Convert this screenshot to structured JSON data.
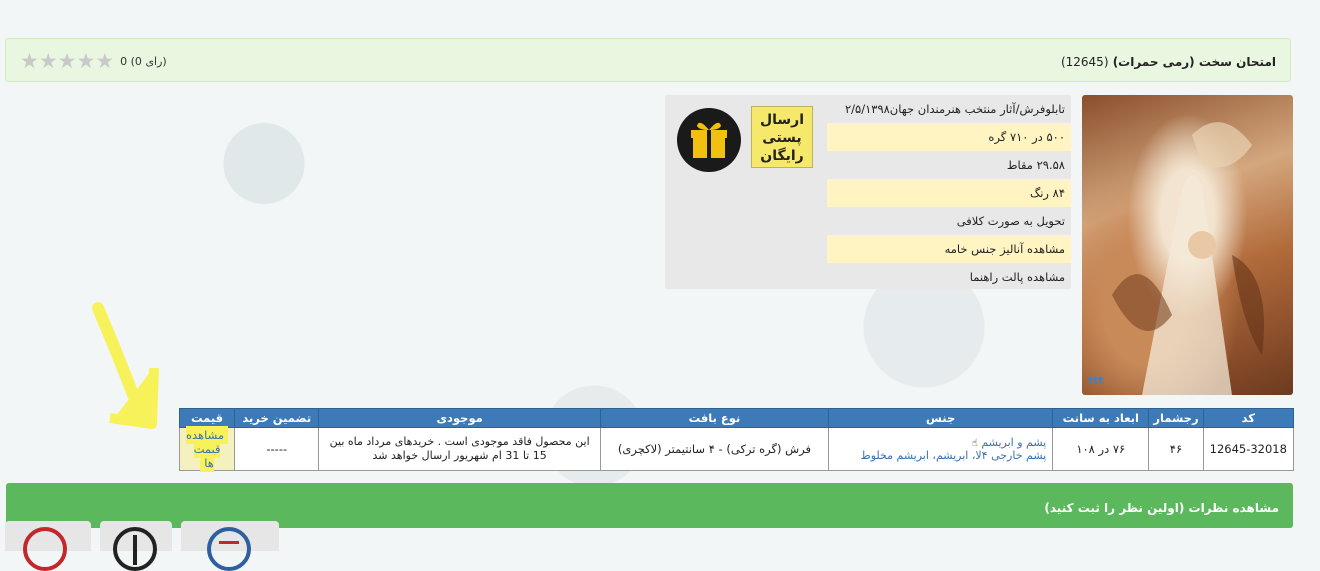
{
  "header": {
    "title": "امتحان سخت (رمی حمرات)",
    "product_code": "(12645)",
    "rating_text": "0 (0 رای)",
    "stars": 5
  },
  "image": {
    "watermark": "ttt"
  },
  "badges": {
    "free_post": [
      "ارسال",
      "پستی",
      "رایگان"
    ]
  },
  "specs": [
    {
      "text": "تابلوفرش/آثار منتخب هنرمندان جهان۲/۵/۱۳۹۸",
      "highlight": false
    },
    {
      "text": "۵۰۰ در ۷۱۰ گره",
      "highlight": true
    },
    {
      "text": "۲۹.۵۸ مقاط",
      "highlight": false
    },
    {
      "text": "۸۴ رنگ",
      "highlight": true
    },
    {
      "text": "تحویل به صورت کلافی",
      "highlight": false
    },
    {
      "text": "مشاهده آنالیز جنس خامه",
      "highlight": true
    },
    {
      "text": "مشاهده پالت راهنما",
      "highlight": false
    }
  ],
  "table": {
    "headers": [
      "کد",
      "رجشمار",
      "ابعاد به سانت",
      "جنس",
      "نوع بافت",
      "موجودی",
      "تضمین خرید",
      "قیمت"
    ],
    "row": {
      "code": "12645-32018",
      "count": "۴۶",
      "dimensions": "۷۶ در ۱۰۸",
      "material_line1": "پشم و ابریشم",
      "material_line2": "پشم خارجی ۴لا، ابریشم، ابریشم مخلوط",
      "weave": "فرش (گره ترکی) - ۴ سانتیمتر (لاکچری)",
      "stock": "این محصول فاقد موجودی است . خریدهای مرداد ماه بین 15 تا 31 ام شهریور ارسال خواهد شد",
      "guarantee": "-----",
      "price_link": "مشاهده قیمت ها"
    }
  },
  "comments": {
    "label": "مشاهده نظرات (اولین نظر را ثبت کنید)"
  },
  "colors": {
    "header_blue": "#3d7ab8",
    "green": "#5cb85c",
    "highlight": "#fff4c2",
    "annotation": "#f8f25a"
  }
}
